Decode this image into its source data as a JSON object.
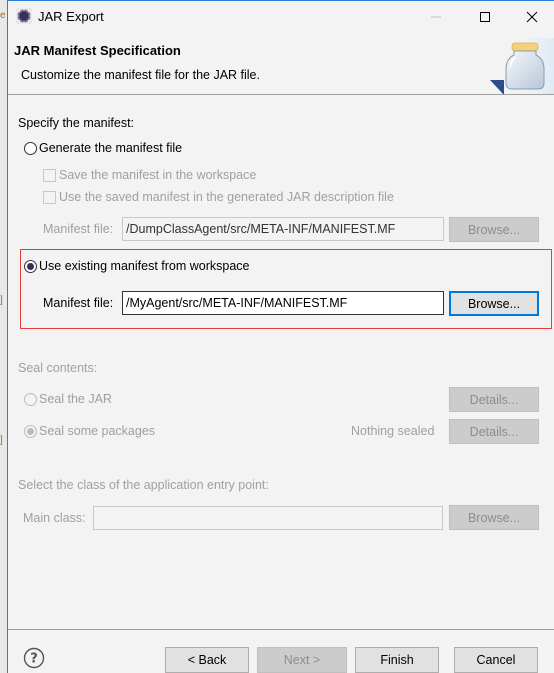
{
  "window": {
    "title": "JAR Export",
    "controls": {
      "minimize": "minimize-icon",
      "maximize": "maximize-icon",
      "close": "close-icon"
    }
  },
  "header": {
    "title": "JAR Manifest Specification",
    "description": "Customize the manifest file for the JAR file."
  },
  "manifest": {
    "section_label": "Specify the manifest:",
    "generate": {
      "label": "Generate the manifest file",
      "selected": false,
      "save_in_workspace": {
        "label": "Save the manifest in the workspace",
        "checked": false,
        "enabled": false
      },
      "use_saved": {
        "label": "Use the saved manifest in the generated JAR description file",
        "checked": false,
        "enabled": false
      },
      "file_label": "Manifest file:",
      "file_value": "/DumpClassAgent/src/META-INF/MANIFEST.MF",
      "browse_label": "Browse..."
    },
    "existing": {
      "label": "Use existing manifest from workspace",
      "selected": true,
      "file_label": "Manifest file:",
      "file_value": "/MyAgent/src/META-INF/MANIFEST.MF",
      "browse_label": "Browse..."
    }
  },
  "seal": {
    "section_label": "Seal contents:",
    "seal_jar": {
      "label": "Seal the JAR",
      "selected": false,
      "details_label": "Details..."
    },
    "seal_packages": {
      "label": "Seal some packages",
      "selected": true,
      "status": "Nothing sealed",
      "details_label": "Details..."
    }
  },
  "entry_point": {
    "section_label": "Select the class of the application entry point:",
    "main_class_label": "Main class:",
    "main_class_value": "",
    "browse_label": "Browse..."
  },
  "footer": {
    "help_icon": "help-icon",
    "back_label": "< Back",
    "next_label": "Next >",
    "finish_label": "Finish",
    "cancel_label": "Cancel"
  },
  "colors": {
    "window_border": "#2b7fd6",
    "highlight_border": "#e53c3c",
    "focus_border": "#0078d7",
    "dialog_bg": "#f3f3f3"
  }
}
